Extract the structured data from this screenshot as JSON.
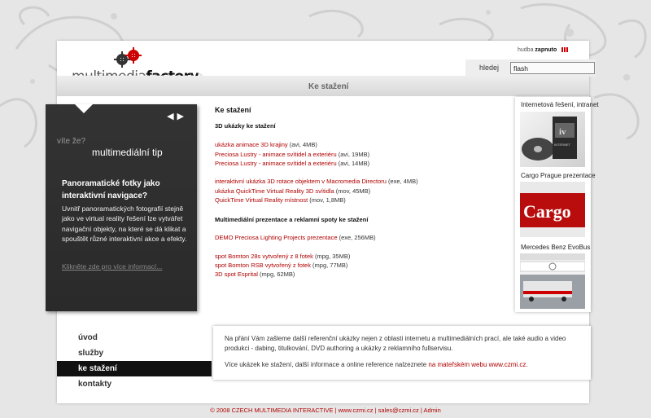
{
  "topbar": {
    "music_label": "hudba",
    "music_state": "zapnuto"
  },
  "search": {
    "label": "hledej",
    "value": "flash"
  },
  "logo": {
    "wordmark_light": "multimedia",
    "wordmark_bold": "factory"
  },
  "page_heading": "Ke stažení",
  "tip": {
    "kicker": "víte že?",
    "label": "multimediální tip",
    "title": "Panoramatické fotky jako interaktivní navigace?",
    "body": "Uvnitř panoramatických fotografií stejně jako ve virtual reality řešení lze vytvářet navigační objekty, na které se dá klikat a spouštět různé interaktivní akce a efekty.",
    "more": "Klikněte zde pro více informací..."
  },
  "main": {
    "title": "Ke stažení",
    "sections": [
      {
        "heading": "3D ukázky ke stažení"
      },
      {
        "heading": "Multimediální prezentace a reklamní spoty ke stažení"
      }
    ],
    "groups": [
      [
        {
          "link": "ukázka animace 3D krajiny",
          "meta": " (avi, 4MB)"
        },
        {
          "link": "Preciosa Lustry - animace svítidel a exteriéru",
          "meta": " (avi, 19MB)"
        },
        {
          "link": "Preciosa Lustry - animace svítidel a exteriéru",
          "meta": " (avi, 14MB)"
        }
      ],
      [
        {
          "link": "interaktivní ukázka 3D rotace objektem v Macromedia Directoru",
          "meta": " (exe, 4MB)"
        },
        {
          "link": "ukázka QuickTime Virtual Reality 3D svítidla",
          "meta": " (mov, 45MB)"
        },
        {
          "link": "QuickTime Virtual Reality místnost",
          "meta": " (mov, 1,8MB)"
        }
      ],
      [
        {
          "link": "DEMO Preciosa Lighting Projects prezentace",
          "meta": " (exe, 256MB)"
        }
      ],
      [
        {
          "link": "spot Bomton 28s vytvořený z 8 fotek",
          "meta": " (mpg, 35MB)"
        },
        {
          "link": "spot Bomton RSB vytvořený z fotek",
          "meta": " (mpg, 77MB)"
        },
        {
          "link": "3D spot Esprital",
          "meta": " (mpg, 62MB)"
        }
      ]
    ]
  },
  "sidebar": [
    {
      "title": "Internetová řešení, intranet",
      "thumb_text": "INTERNET"
    },
    {
      "title": "Cargo Prague prezentace",
      "thumb_text": "Cargo"
    },
    {
      "title": "Mercedes Benz EvoBus",
      "thumb_text": ""
    }
  ],
  "nav": [
    {
      "label": "úvod"
    },
    {
      "label": "služby"
    },
    {
      "label": "ke stažení"
    },
    {
      "label": "kontakty"
    }
  ],
  "info": {
    "p1": "Na přání Vám zašleme další referenční ukázky nejen z oblasti internetu a multimediálních prací, ale také audio a video produkci - dabing, titulkování, DVD authoring a ukázky z reklamního fullservisu.",
    "p2_text": "Více ukázek ke stažení, další informace a online reference nalzeznete ",
    "p2_link": "na mateřském webu www.czmi.cz",
    "p2_end": "."
  },
  "footer": {
    "copyright": "© 2008 CZECH MULTIMEDIA INTERACTIVE",
    "site": "www.czmi.cz",
    "email": "sales@czmi.cz",
    "admin": "Admin",
    "sep": "|"
  },
  "colors": {
    "accent": "#b00000",
    "panel_dark": "#2f2f2f",
    "background": "#e6e6e6"
  }
}
